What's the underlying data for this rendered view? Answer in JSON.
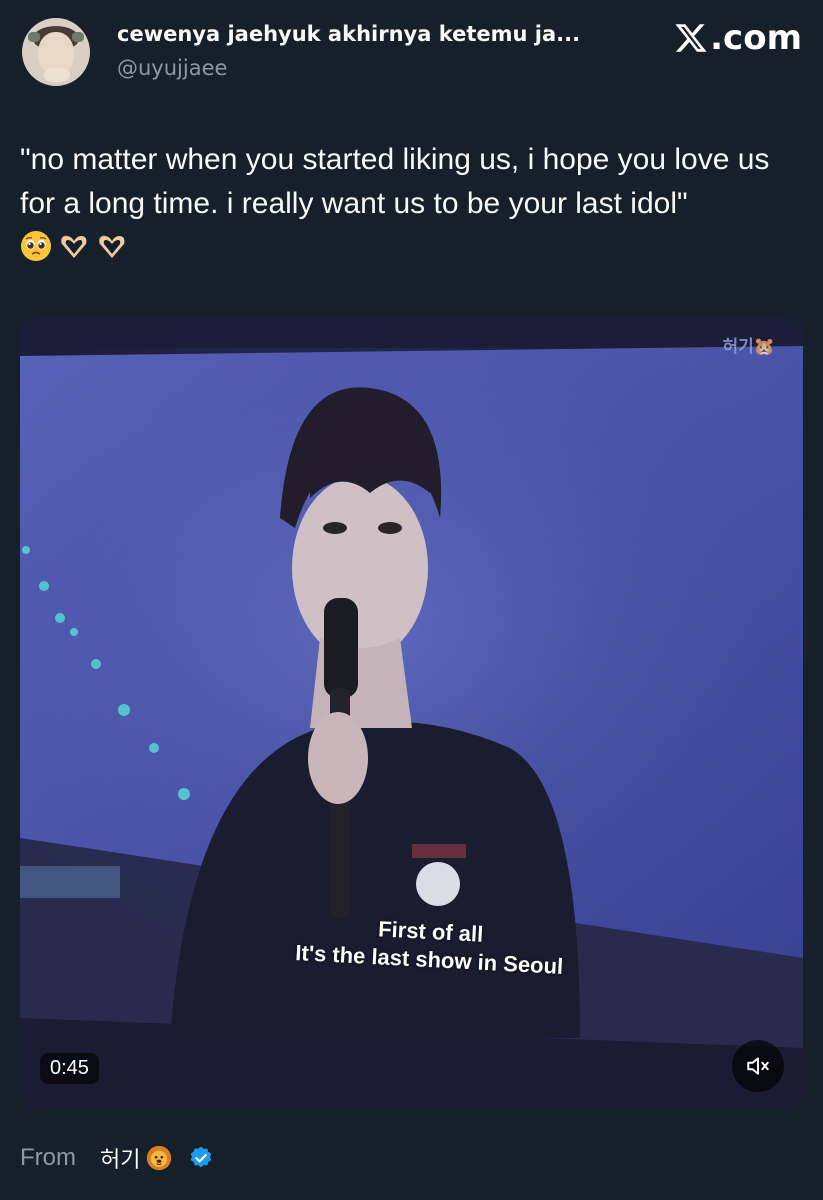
{
  "post": {
    "display_name": "cewenya jaehyuk akhirnya ketemu ja...",
    "handle": "@uyujjaee",
    "site_label": ".com",
    "text": "\"no matter when you started liking us, i hope you love us for a long time. i really want us to be your last idol\"",
    "emojis": [
      "pleading-face",
      "heart-hands",
      "heart-hands"
    ]
  },
  "media": {
    "watermark": "허기🐹",
    "subtitle_line1": "First of all",
    "subtitle_line2": "It's the last show in Seoul",
    "duration": "0:45",
    "muted": true
  },
  "source": {
    "from_label": "From",
    "account_name": "허기",
    "verified": true
  },
  "colors": {
    "background": "#15202b",
    "text_primary": "#f7f9f9",
    "text_secondary": "#8b98a5",
    "verified_blue": "#1d9bf0"
  }
}
